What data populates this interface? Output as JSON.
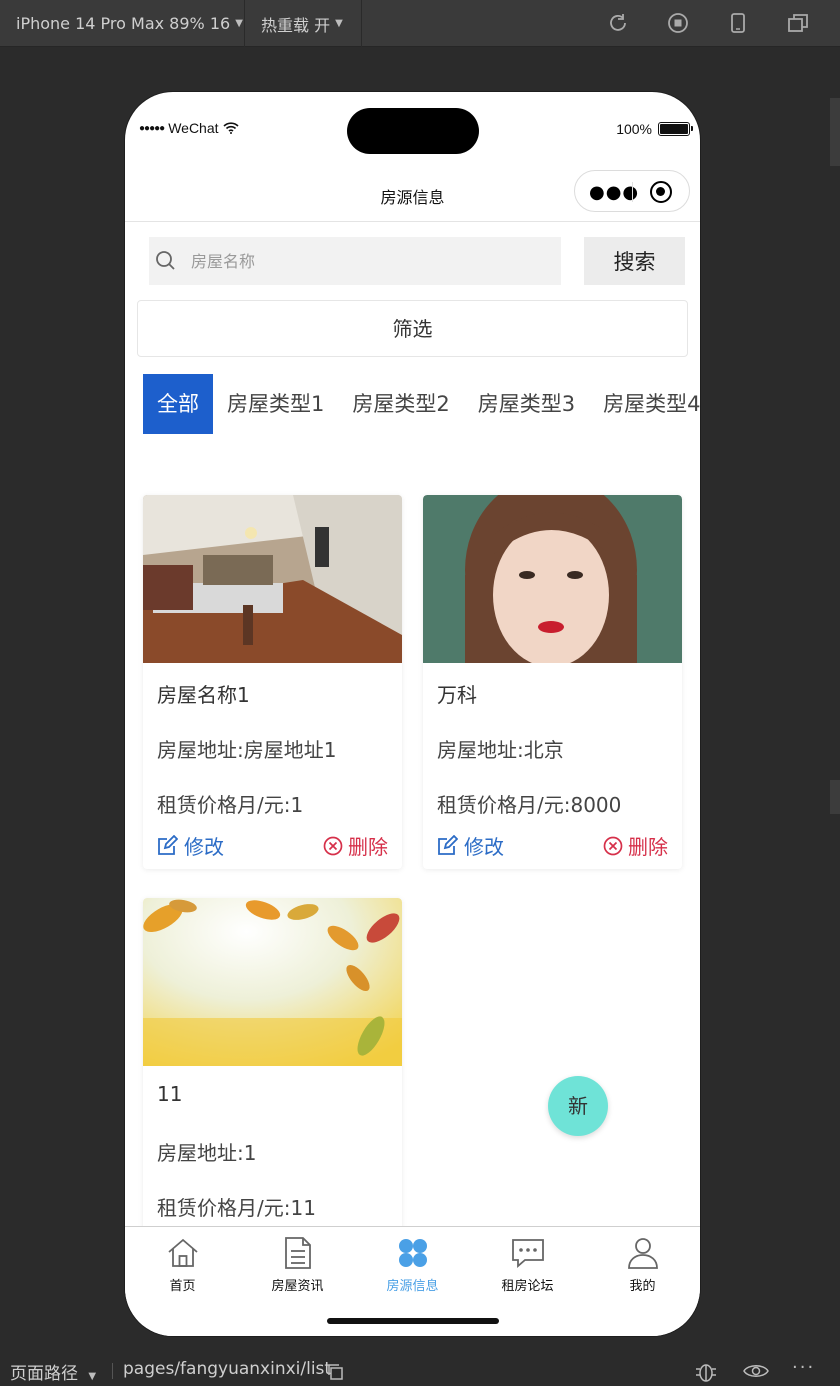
{
  "ide": {
    "device_label": "iPhone 14 Pro Max 89% 16",
    "hot_reload_label": "热重载 开",
    "path_label": "页面路径",
    "path": "pages/fangyuanxinxi/list"
  },
  "status_bar": {
    "carrier": "WeChat",
    "battery": "100%"
  },
  "navbar": {
    "title": "房源信息"
  },
  "search": {
    "placeholder": "房屋名称",
    "value": "",
    "button_label": "搜索"
  },
  "filter": {
    "label": "筛选"
  },
  "tabs": [
    {
      "label": "全部",
      "active": true
    },
    {
      "label": "房屋类型1",
      "active": false
    },
    {
      "label": "房屋类型2",
      "active": false
    },
    {
      "label": "房屋类型3",
      "active": false
    },
    {
      "label": "房屋类型4",
      "active": false
    }
  ],
  "cards": [
    {
      "name": "房屋名称1",
      "address": "房屋地址:房屋地址1",
      "price": "租赁价格月/元:1",
      "edit_label": "修改",
      "delete_label": "删除"
    },
    {
      "name": "万科",
      "address": "房屋地址:北京",
      "price": "租赁价格月/元:8000",
      "edit_label": "修改",
      "delete_label": "删除"
    },
    {
      "name": "11",
      "address": "房屋地址:1",
      "price": "租赁价格月/元:11"
    }
  ],
  "fab": {
    "label": "新"
  },
  "tabbar": [
    {
      "label": "首页",
      "icon": "home-icon",
      "active": false
    },
    {
      "label": "房屋资讯",
      "icon": "document-icon",
      "active": false
    },
    {
      "label": "房源信息",
      "icon": "grid-icon",
      "active": true
    },
    {
      "label": "租房论坛",
      "icon": "chat-icon",
      "active": false
    },
    {
      "label": "我的",
      "icon": "user-icon",
      "active": false
    }
  ],
  "colors": {
    "tab_active": "#1d5fcc",
    "edit": "#2c6cc6",
    "delete": "#d6304a",
    "fab": "#6fe3d7",
    "tabbar_active": "#4aa0e6"
  }
}
